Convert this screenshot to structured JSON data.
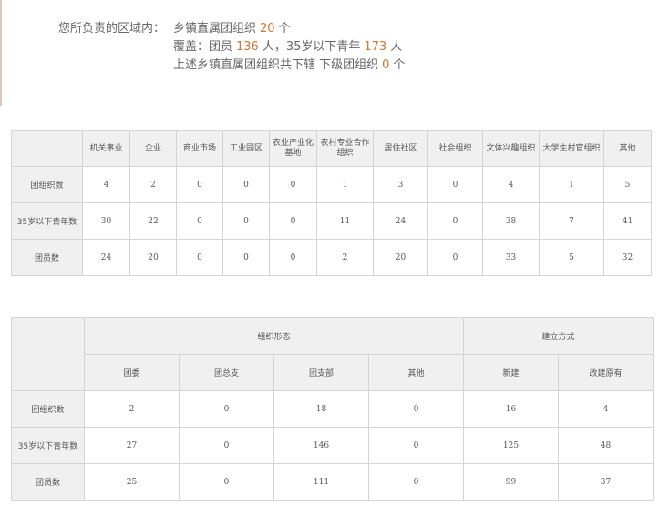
{
  "summary": {
    "line1_label": "您所负责的区域内：",
    "line1_text": "乡镇直属团组织",
    "line1_count": "20",
    "line1_unit": "个",
    "line2_prefix": "覆盖：团员",
    "line2_members": "136",
    "line2_mid": "人，35岁以下青年",
    "line2_youth": "173",
    "line2_unit": "人",
    "line3_text": "上述乡镇直属团组织共下辖 下级团组织",
    "line3_count": "0",
    "line3_unit": "个"
  },
  "table1": {
    "columns": [
      "机关事业",
      "企业",
      "商业市场",
      "工业园区",
      "农业产业化基地",
      "农村专业合作组织",
      "居住社区",
      "社会组织",
      "文体兴趣组织",
      "大学生村官组织",
      "其他"
    ],
    "rows": [
      {
        "label": "团组织数",
        "values": [
          "4",
          "2",
          "0",
          "0",
          "0",
          "1",
          "3",
          "0",
          "4",
          "1",
          "5"
        ]
      },
      {
        "label": "35岁以下青年数",
        "values": [
          "30",
          "22",
          "0",
          "0",
          "0",
          "11",
          "24",
          "0",
          "38",
          "7",
          "41"
        ]
      },
      {
        "label": "团员数",
        "values": [
          "24",
          "20",
          "0",
          "0",
          "0",
          "2",
          "20",
          "0",
          "33",
          "5",
          "32"
        ]
      }
    ]
  },
  "table2": {
    "group_form": "组织形态",
    "group_method": "建立方式",
    "columns": [
      "团委",
      "团总支",
      "团支部",
      "其他",
      "新建",
      "改建原有"
    ],
    "rows": [
      {
        "label": "团组织数",
        "values": [
          "2",
          "0",
          "18",
          "0",
          "16",
          "4"
        ]
      },
      {
        "label": "35岁以下青年数",
        "values": [
          "27",
          "0",
          "146",
          "0",
          "125",
          "48"
        ]
      },
      {
        "label": "团员数",
        "values": [
          "25",
          "0",
          "111",
          "0",
          "99",
          "37"
        ]
      }
    ]
  }
}
